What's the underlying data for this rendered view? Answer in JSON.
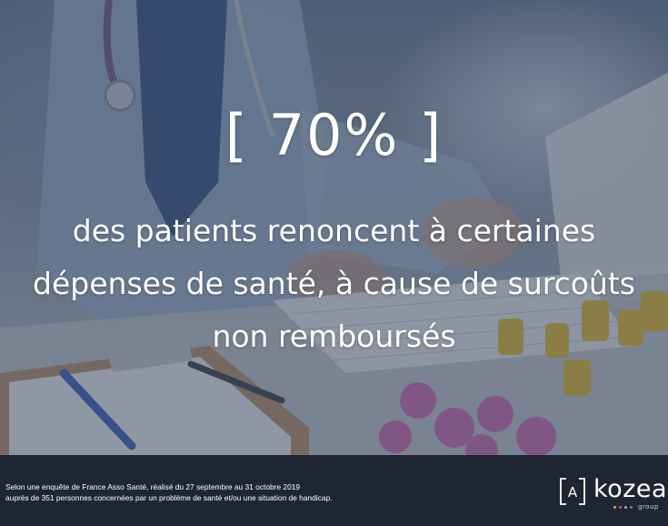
{
  "headline": {
    "value": "[ 70% ]"
  },
  "subline": {
    "lines": [
      "des patients renoncent à certaines",
      "dépenses de santé, à cause de surcoûts",
      "non remboursés"
    ]
  },
  "footer": {
    "source_lines": [
      "Selon une enquête  de France Asso Santé, réalisé du 27 septembre au 31 octobre 2019",
      "auprès de 351 personnes concernées par un problème de santé et/ou une situation de handicap."
    ]
  },
  "logo": {
    "mark_letter": "A",
    "word": "kozea",
    "group_label": "group",
    "dot_colors": [
      "#e2a13b",
      "#d94a7b",
      "#7cc3d8",
      "#8a6fc4"
    ]
  },
  "colors": {
    "footer_background": "#1f2633",
    "overlay": "#344258",
    "text": "#ffffff"
  }
}
